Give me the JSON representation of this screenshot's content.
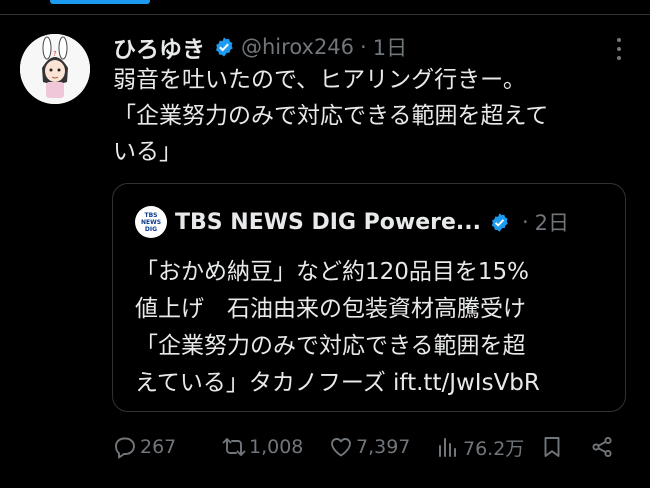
{
  "tweet": {
    "display_name": "ひろゆき",
    "handle": "@hirox246",
    "separator": "·",
    "time": "1日",
    "lines": [
      "弱音を吐いたので、ヒアリング行きー。",
      "「企業努力のみで対応できる範囲を超えて",
      "いる」"
    ]
  },
  "quote": {
    "logo_lines": [
      "TBS",
      "NEWS",
      "DIG"
    ],
    "display_name": "TBS NEWS DIG Powere...",
    "separator": "·",
    "time": "2日",
    "lines": [
      "「おかめ納豆」など約120品目を15%",
      "値上げ　石油由来の包装資材高騰受け",
      "「企業努力のみで対応できる範囲を超",
      "えている」タカノフーズ ift.tt/JwIsVbR"
    ]
  },
  "actions": {
    "replies": "267",
    "retweets": "1,008",
    "likes": "7,397",
    "views": "76.2万"
  },
  "colors": {
    "background": "#000000",
    "text": "#e7e9ea",
    "muted": "#71767b",
    "accent": "#1d9bf0",
    "border": "#2f3336"
  },
  "icons": [
    "verified-badge-icon",
    "more-icon",
    "reply-icon",
    "retweet-icon",
    "like-icon",
    "views-icon",
    "bookmark-icon",
    "share-icon"
  ]
}
